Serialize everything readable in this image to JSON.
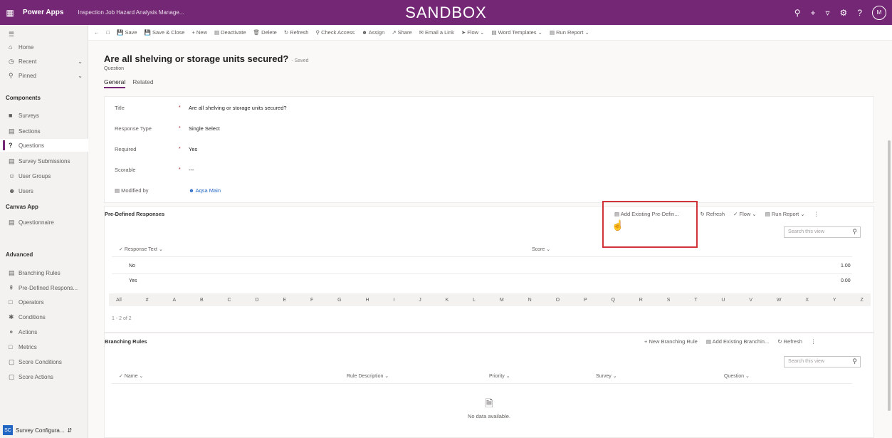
{
  "topbar": {
    "app_name": "Power Apps",
    "environment": "Inspection Job Hazard Analysis Manage...",
    "banner": "SANDBOX",
    "avatar_initials": "M",
    "accent_color": "#742774"
  },
  "sidebar": {
    "items_top": [
      {
        "label": "Home",
        "icon": "home-icon"
      },
      {
        "label": "Recent",
        "icon": "clock-icon"
      },
      {
        "label": "Pinned",
        "icon": "pin-icon"
      }
    ],
    "group_components": "Components",
    "items_components": [
      {
        "label": "Surveys",
        "icon": "survey-icon"
      },
      {
        "label": "Sections",
        "icon": "section-icon"
      },
      {
        "label": "Questions",
        "icon": "question-icon"
      },
      {
        "label": "Survey Submissions",
        "icon": "submission-icon"
      },
      {
        "label": "User Groups",
        "icon": "group-icon"
      },
      {
        "label": "Users",
        "icon": "user-icon"
      }
    ],
    "group_canvas": "Canvas App",
    "items_canvas": [
      {
        "label": "Questionnaire",
        "icon": "doc-icon"
      }
    ],
    "group_advanced": "Advanced",
    "items_advanced": [
      {
        "label": "Branching Rules",
        "icon": "rule-icon"
      },
      {
        "label": "Pre-Defined Respons...",
        "icon": "response-icon"
      },
      {
        "label": "Operators",
        "icon": "operator-icon"
      },
      {
        "label": "Conditions",
        "icon": "condition-icon"
      },
      {
        "label": "Actions",
        "icon": "action-icon"
      },
      {
        "label": "Metrics",
        "icon": "metric-icon"
      },
      {
        "label": "Score Conditions",
        "icon": "score-icon"
      },
      {
        "label": "Score Actions",
        "icon": "score-action-icon"
      }
    ],
    "area_badge": "SC",
    "area_label": "Survey Configura..."
  },
  "commandbar": {
    "items": [
      "Save",
      "Save & Close",
      "+ New",
      "Deactivate",
      "Delete",
      "Refresh",
      "Check Access",
      "Assign",
      "Share",
      "Email a Link",
      "Flow",
      "Word Templates",
      "Run Report"
    ]
  },
  "record": {
    "title": "Are all shelving or storage units secured?",
    "saved": "- Saved",
    "entity": "Question",
    "tabs": [
      "General",
      "Related"
    ]
  },
  "fields": [
    {
      "label": "Title",
      "value": "Are all shelving or storage units secured?"
    },
    {
      "label": "Response Type",
      "value": "Single Select"
    },
    {
      "label": "Required",
      "value": "Yes"
    },
    {
      "label": "Scorable",
      "value": "---"
    },
    {
      "label": "Modified by",
      "value": "Aqsa Main"
    }
  ],
  "pdr_grid": {
    "title": "Pre-Defined Responses",
    "buttons": [
      "Add Existing Pre-Defin...",
      "Refresh",
      "Flow",
      "Run Report"
    ],
    "search_placeholder": "Search this view",
    "headers": [
      "Response Text",
      "Score"
    ],
    "rows": [
      {
        "text": "No",
        "score": "1.00"
      },
      {
        "text": "Yes",
        "score": "0.00"
      }
    ],
    "alpha": [
      "All",
      "#",
      "A",
      "B",
      "C",
      "D",
      "E",
      "F",
      "G",
      "H",
      "I",
      "J",
      "K",
      "L",
      "M",
      "N",
      "O",
      "P",
      "Q",
      "R",
      "S",
      "T",
      "U",
      "V",
      "W",
      "X",
      "Y",
      "Z"
    ],
    "count": "1 - 2 of 2"
  },
  "br_grid": {
    "title": "Branching Rules",
    "buttons": [
      "New Branching Rule",
      "Add Existing Branchin...",
      "Refresh"
    ],
    "search_placeholder": "Search this view",
    "headers": [
      "Name",
      "Rule Description",
      "Priority",
      "Survey",
      "Question"
    ],
    "empty": "No data available."
  }
}
